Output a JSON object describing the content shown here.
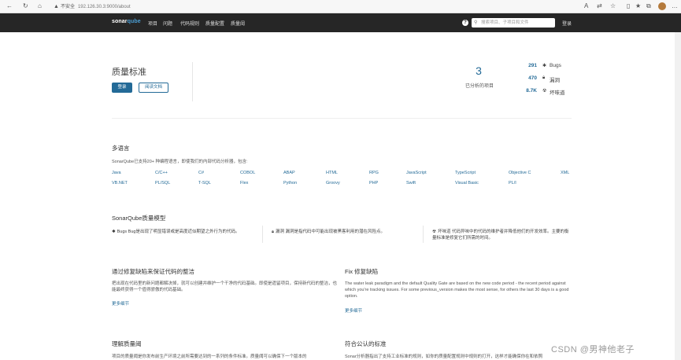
{
  "browser": {
    "security_label": "不安全",
    "url": "192.126.30.3:9000/about"
  },
  "header": {
    "logo_prefix": "sonar",
    "logo_suffix": "qube",
    "menu": [
      "项目",
      "问题",
      "代码规则",
      "质量配置",
      "质量阈"
    ],
    "help": "?",
    "search_placeholder": "搜索项目、子项目和文件",
    "login": "登录"
  },
  "hero": {
    "title": "质量标准",
    "login_button": "登录",
    "docs_button": "阅读文档",
    "projects_count": "3",
    "projects_label": "已分析的项目",
    "stats": [
      {
        "value": "291",
        "label": "Bugs",
        "icon": "bug-icon"
      },
      {
        "value": "470",
        "label": "漏洞",
        "icon": "lock-icon"
      },
      {
        "value": "8.7K",
        "label": "坏味道",
        "icon": "smell-icon"
      }
    ]
  },
  "languages": {
    "title": "多语言",
    "description": "SonarQube已支持20+ 种编程语言，即使我们的内部代码分析器，包含:",
    "row1": [
      "Java",
      "C/C++",
      "C#",
      "COBOL",
      "ABAP",
      "HTML",
      "RPG",
      "JavaScript",
      "TypeScript",
      "Objective C",
      "XML"
    ],
    "row2": [
      "VB.NET",
      "PL/SQL",
      "T-SQL",
      "Flex",
      "Python",
      "Groovy",
      "PHP",
      "Swift",
      "Visual Basic",
      "PL/I"
    ]
  },
  "quality_model": {
    "title": "SonarQube质量模型",
    "items": [
      {
        "text": "Bugs Bug是出现了明显错误或是高度近似期望之外行为的代码。"
      },
      {
        "text": "漏洞 漏洞是指代码中可能出现被黑客利用的潜在风险点。"
      },
      {
        "text": "坏味道 代码异味中的代码的维护者并降低他们的开发效率。主要的衡量标准是修复它们所需的时间。"
      }
    ]
  },
  "leak": {
    "title": "通过修复缺陷来保证代码的整洁",
    "text": "把出现在代码里的新问题都解决掉，就可以创建并维护一个干净的代码基础。即使是遗留项目，保持新代码的整洁，也能最终获得一个值得骄傲的代码基础。",
    "more": "更多细节"
  },
  "fix": {
    "title": "Fix 修复缺陷",
    "text": "The water leak paradigm and the default Quality Gate are based on the new code period - the recent period against which you're tracking issues. For some previous_version makes the most sense, for others the last 30 days is a good option.",
    "more": "更多细节"
  },
  "gate": {
    "title": "理解质量阈",
    "text": "项目的质量阈是你发布前生产环境之前所需要达到的一系列的条件标准。质量阈可以确保下一个版本的"
  },
  "standards": {
    "title": "符合公认的标准",
    "text": "Sonar分析器指出了支持工业标准的规则，如你的质量配置规则中规则的打开，这样才能确保你在和依照"
  },
  "watermark": "CSDN @男神他老子"
}
